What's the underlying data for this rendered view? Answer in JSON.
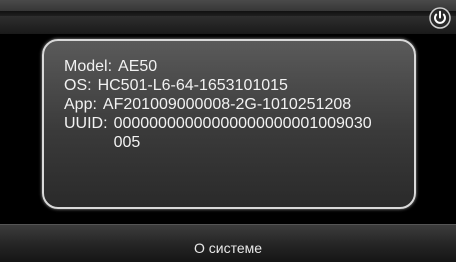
{
  "header": {
    "power_icon": "power-icon"
  },
  "info": {
    "model_label": "Model:",
    "model_value": "AE50",
    "os_label": "OS:",
    "os_value": "HC501-L6-64-1653101015",
    "app_label": "App:",
    "app_value": "AF201009000008-2G-1010251208",
    "uuid_label": "UUID:",
    "uuid_value": "00000000000000000000001009030005"
  },
  "footer": {
    "title": "О системе"
  }
}
